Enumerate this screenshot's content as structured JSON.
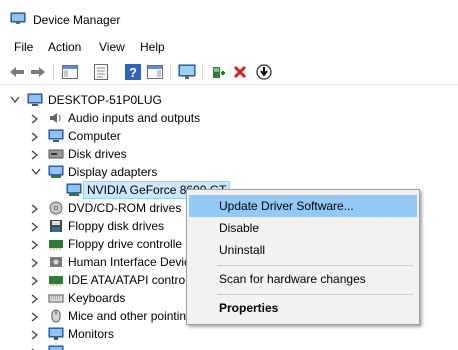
{
  "window": {
    "title": "Device Manager"
  },
  "menu": {
    "items": [
      "File",
      "Action",
      "View",
      "Help"
    ]
  },
  "toolbar": {
    "buttons": [
      "back-arrow",
      "forward-arrow",
      "show-hide-console-tree",
      "properties",
      "help",
      "action-pane",
      "scan-monitor",
      "update-driver",
      "uninstall-x",
      "download-driver"
    ]
  },
  "tree": {
    "root": "DESKTOP-51P0LUG",
    "items": [
      {
        "label": "Audio inputs and outputs",
        "icon": "speaker-icon"
      },
      {
        "label": "Computer",
        "icon": "computer-icon"
      },
      {
        "label": "Disk drives",
        "icon": "disk-drive-icon"
      },
      {
        "label": "Display adapters",
        "icon": "display-adapter-icon",
        "expanded": true
      },
      {
        "label": "NVIDIA GeForce 8600 GT",
        "icon": "display-adapter-icon",
        "selected": true
      },
      {
        "label": "DVD/CD-ROM drives",
        "icon": "dvd-icon"
      },
      {
        "label": "Floppy disk drives",
        "icon": "floppy-icon"
      },
      {
        "label": "Floppy drive controlle",
        "icon": "controller-icon"
      },
      {
        "label": "Human Interface Devic",
        "icon": "hid-icon"
      },
      {
        "label": "IDE ATA/ATAPI contro",
        "icon": "ide-icon"
      },
      {
        "label": "Keyboards",
        "icon": "keyboard-icon"
      },
      {
        "label": "Mice and other pointing",
        "icon": "mouse-icon"
      },
      {
        "label": "Monitors",
        "icon": "monitor-icon"
      }
    ]
  },
  "context_menu": {
    "items": [
      {
        "label": "Update Driver Software...",
        "highlighted": true
      },
      {
        "label": "Disable"
      },
      {
        "label": "Uninstall"
      },
      {
        "label": "Scan for hardware changes"
      },
      {
        "label": "Properties",
        "bold": true
      }
    ]
  },
  "colors": {
    "selection_fill": "#cce8ff",
    "selection_border": "#99d1ff",
    "menu_highlight": "#91c9f7",
    "menu_background": "#f2f2f2"
  }
}
